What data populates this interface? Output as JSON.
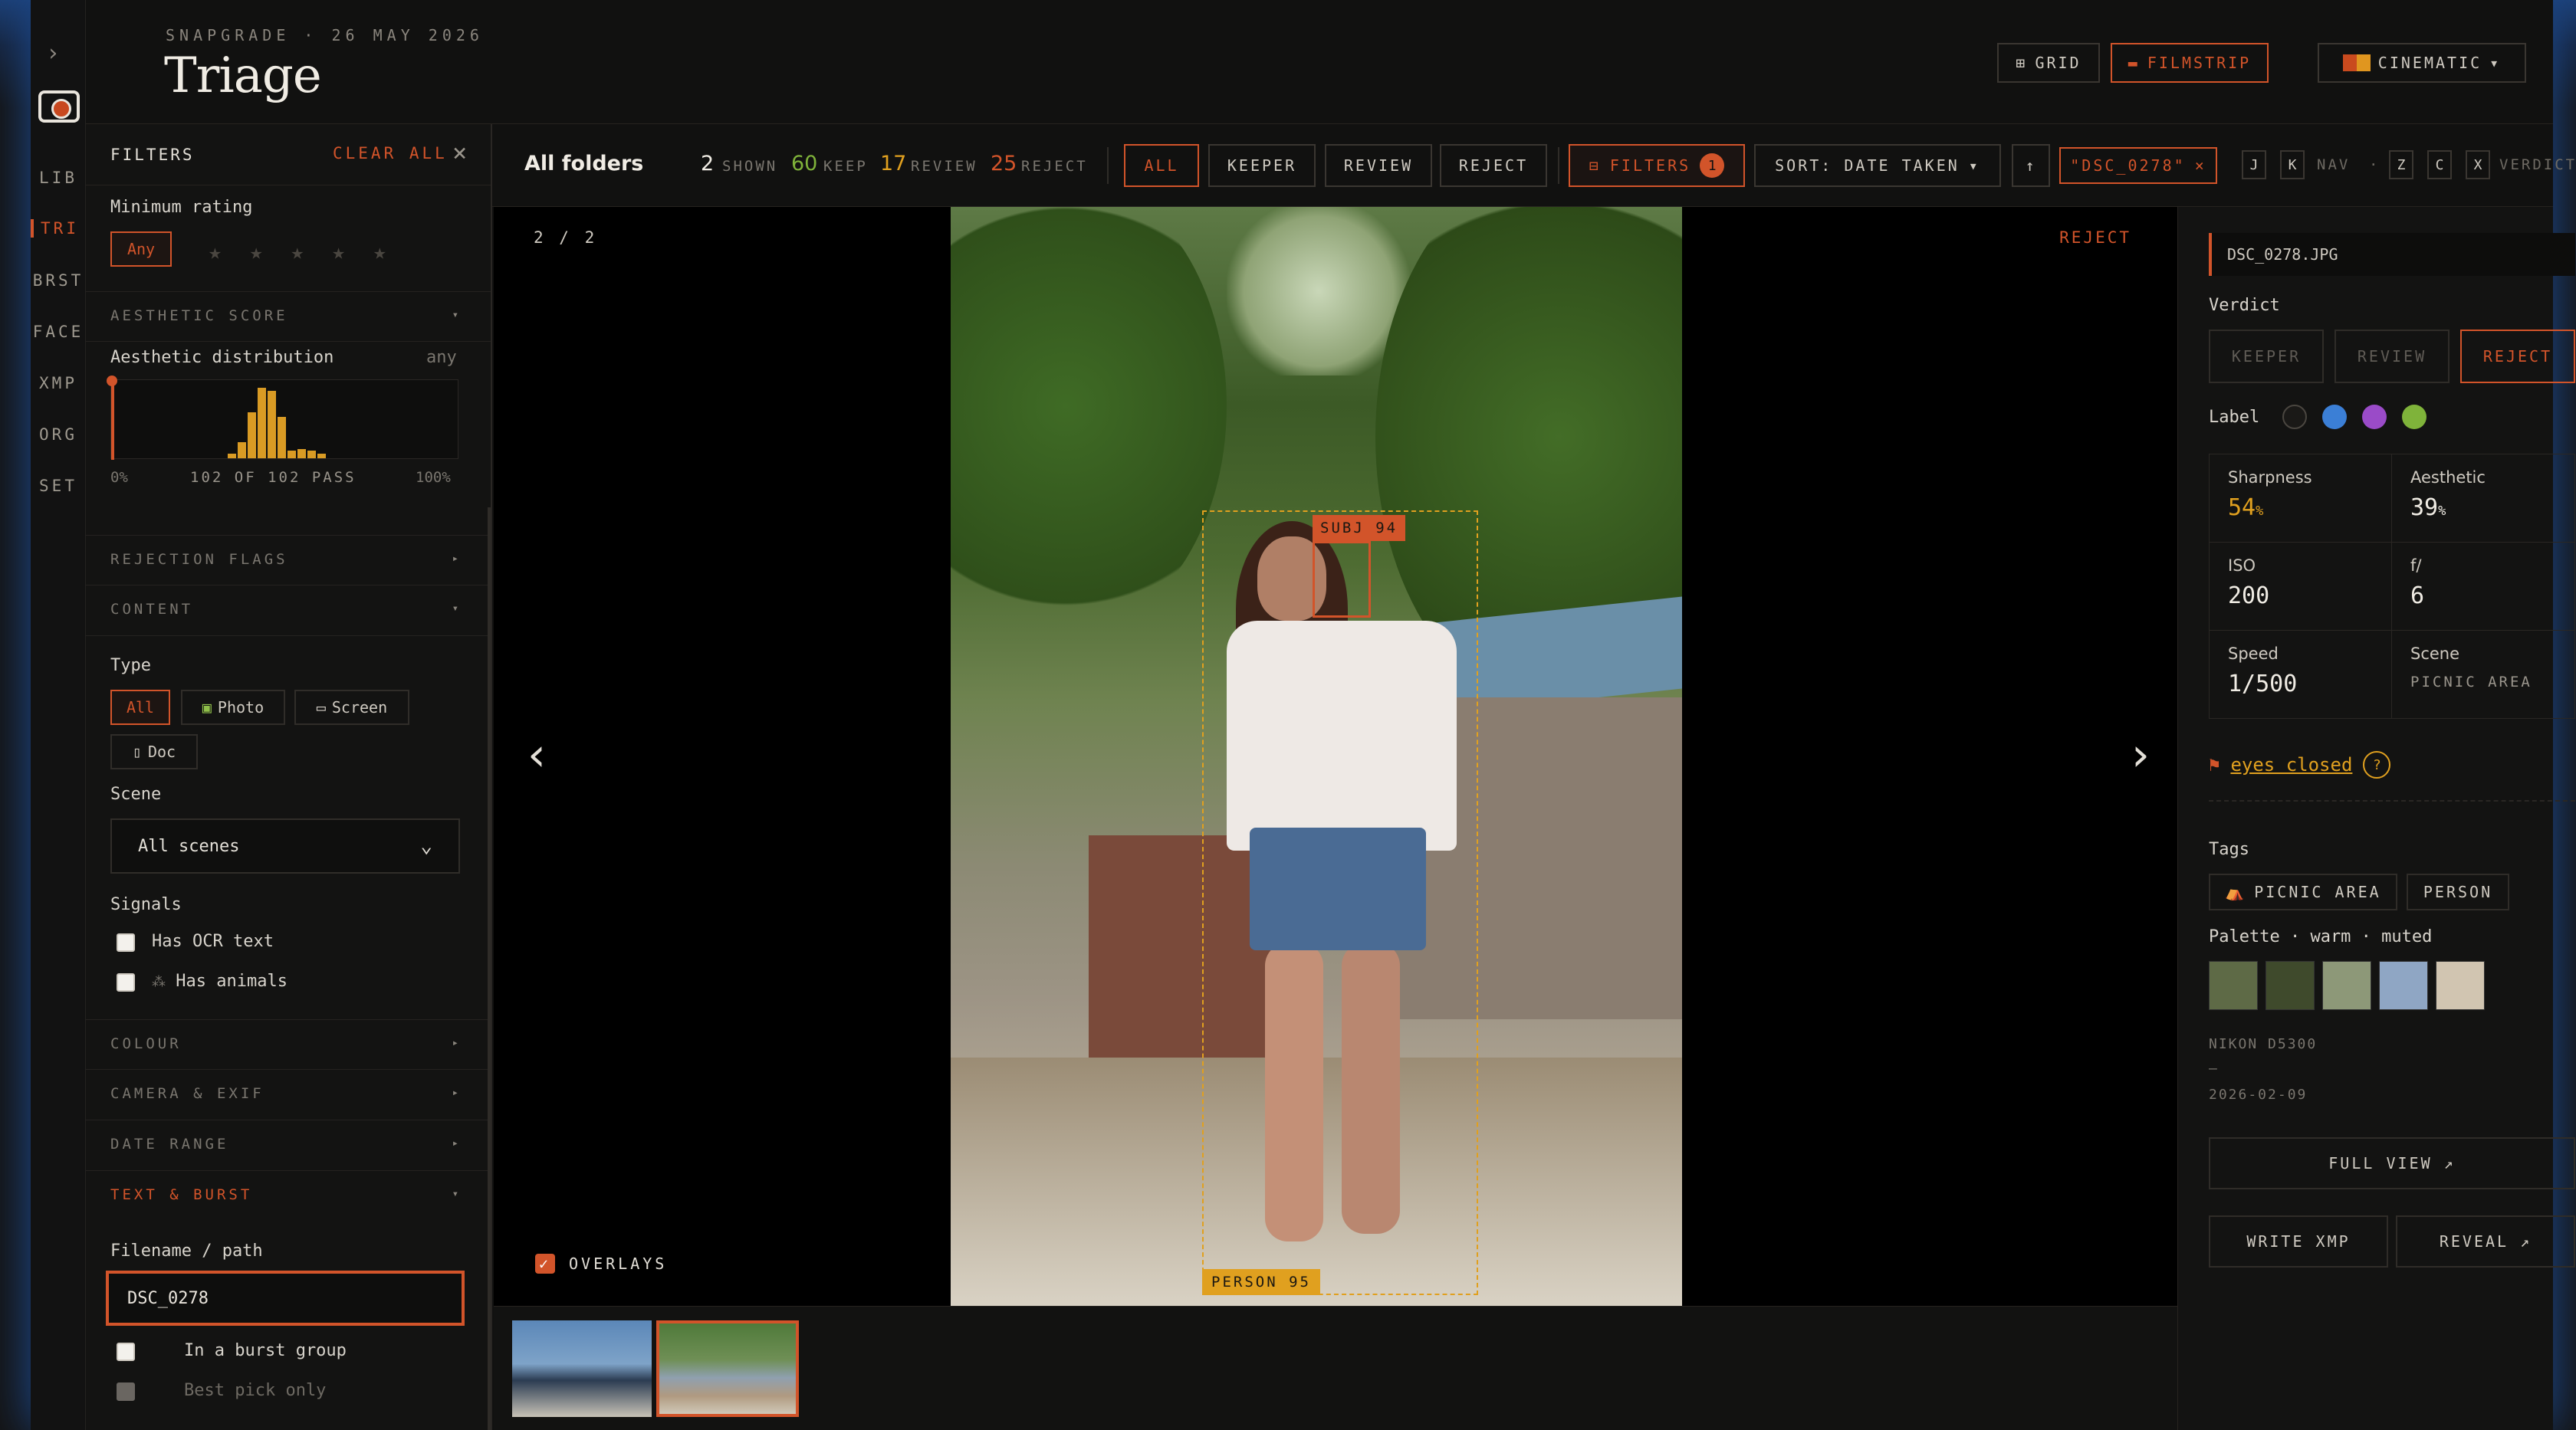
{
  "rail": {
    "expand": "›",
    "items": [
      "LIB",
      "TRI",
      "BRST",
      "FACE",
      "XMP",
      "ORG",
      "SET"
    ],
    "active": "TRI"
  },
  "header": {
    "subtitle": "SNAPGRADE · 26 MAY 2026",
    "title": "Triage",
    "grid_label": "GRID",
    "filmstrip_label": "FILMSTRIP",
    "cinematic_label": "CINEMATIC",
    "grid_icon": "⊞",
    "filmstrip_icon": "▬",
    "caret": "▾"
  },
  "filters": {
    "title": "FILTERS",
    "clear_all": "CLEAR ALL",
    "close": "×",
    "min_rating_label": "Minimum rating",
    "rating_any": "Any",
    "stars": "★ ★ ★ ★ ★",
    "sections": {
      "aesthetic": "AESTHETIC SCORE",
      "rejection": "REJECTION FLAGS",
      "content": "CONTENT",
      "colour": "COLOUR",
      "camera": "CAMERA & EXIF",
      "date": "DATE RANGE",
      "text_burst": "TEXT & BURST"
    },
    "aesthetic_dist_label": "Aesthetic distribution",
    "aesthetic_dist_value": "any",
    "hist_min": "0%",
    "hist_pass": "102 OF 102 PASS",
    "hist_max": "100%",
    "hist_bins": [
      0.06,
      0.22,
      0.62,
      0.96,
      0.92,
      0.56,
      0.1,
      0.12,
      0.1,
      0.06
    ],
    "type_label": "Type",
    "types": [
      "All",
      "Photo",
      "Screen",
      "Doc"
    ],
    "scene_label": "Scene",
    "scene_value": "All scenes",
    "signals_label": "Signals",
    "signal_ocr": "Has OCR text",
    "signal_animals": "Has animals",
    "filename_label": "Filename / path",
    "filename_value": "DSC_0278",
    "burst_label": "In a burst group",
    "best_pick_label": "Best pick only"
  },
  "toolbar": {
    "title": "All folders",
    "shown": "2",
    "shown_label": "SHOWN",
    "keep": "60",
    "keep_label": "KEEP",
    "review": "17",
    "review_label": "REVIEW",
    "reject": "25",
    "reject_label": "REJECT",
    "btn_all": "ALL",
    "btn_keeper": "KEEPER",
    "btn_review": "REVIEW",
    "btn_reject": "REJECT",
    "filters_label": "FILTERS",
    "filters_count": "1",
    "sort_label": "SORT: DATE TAKEN",
    "sort_dir": "↑",
    "query_chip": "\"DSC_0278\"",
    "chip_close": "×",
    "key_j": "J",
    "key_k": "K",
    "nav_label": "NAV",
    "dot": "·",
    "key_z": "Z",
    "key_c": "C",
    "key_x": "X",
    "verdict_label": "VERDICT"
  },
  "viewer": {
    "counter": "2 / 2",
    "verdict": "REJECT",
    "prev": "‹",
    "next": "›",
    "face_label": "SUBJ 94",
    "person_label": "PERSON 95",
    "overlays_label": "OVERLAYS",
    "overlays_check": "✓"
  },
  "details": {
    "filename": "DSC_0278.JPG",
    "verdict_label": "Verdict",
    "verdict_keeper": "KEEPER",
    "verdict_review": "REVIEW",
    "verdict_reject": "REJECT",
    "label_label": "Label",
    "label_colors": [
      "#1a1917",
      "#3b7fd6",
      "#9a4bc8",
      "#7fb33a"
    ],
    "sharpness_label": "Sharpness",
    "sharpness_value": "54",
    "aesthetic_label": "Aesthetic",
    "aesthetic_value": "39",
    "pct": "%",
    "iso_label": "ISO",
    "iso_value": "200",
    "f_label": "f/",
    "f_value": "6",
    "speed_label": "Speed",
    "speed_value": "1/500",
    "scene_label": "Scene",
    "scene_value": "PICNIC AREA",
    "flag_icon": "⚑",
    "flag_text": "eyes closed",
    "flag_help": "?",
    "tags_label": "Tags",
    "tag_1": "PICNIC AREA",
    "tag_1_icon": "⛺",
    "tag_2": "PERSON",
    "palette_label": "Palette · warm · muted",
    "palette": [
      "#5e6a46",
      "#3f4a2c",
      "#8d9878",
      "#8fa6c4",
      "#d1c5b1"
    ],
    "camera": "NIKON D5300",
    "lens": "—",
    "date": "2026-02-09",
    "full_view": "FULL VIEW ↗",
    "write_xmp": "WRITE XMP",
    "reveal": "REVEAL ↗"
  }
}
